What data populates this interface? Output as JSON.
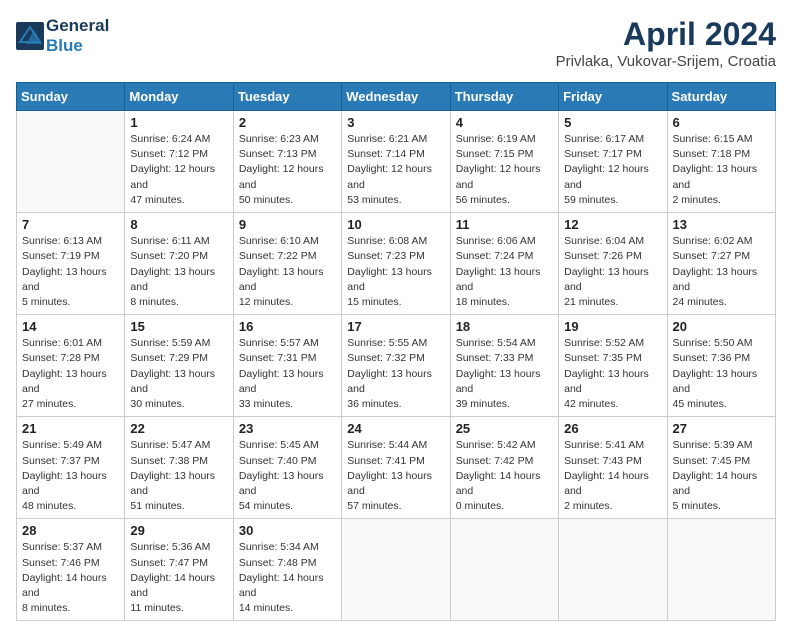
{
  "header": {
    "logo_line1": "General",
    "logo_line2": "Blue",
    "month": "April 2024",
    "location": "Privlaka, Vukovar-Srijem, Croatia"
  },
  "weekdays": [
    "Sunday",
    "Monday",
    "Tuesday",
    "Wednesday",
    "Thursday",
    "Friday",
    "Saturday"
  ],
  "weeks": [
    [
      {
        "day": "",
        "sunrise": "",
        "sunset": "",
        "daylight": ""
      },
      {
        "day": "1",
        "sunrise": "Sunrise: 6:24 AM",
        "sunset": "Sunset: 7:12 PM",
        "daylight": "Daylight: 12 hours and 47 minutes."
      },
      {
        "day": "2",
        "sunrise": "Sunrise: 6:23 AM",
        "sunset": "Sunset: 7:13 PM",
        "daylight": "Daylight: 12 hours and 50 minutes."
      },
      {
        "day": "3",
        "sunrise": "Sunrise: 6:21 AM",
        "sunset": "Sunset: 7:14 PM",
        "daylight": "Daylight: 12 hours and 53 minutes."
      },
      {
        "day": "4",
        "sunrise": "Sunrise: 6:19 AM",
        "sunset": "Sunset: 7:15 PM",
        "daylight": "Daylight: 12 hours and 56 minutes."
      },
      {
        "day": "5",
        "sunrise": "Sunrise: 6:17 AM",
        "sunset": "Sunset: 7:17 PM",
        "daylight": "Daylight: 12 hours and 59 minutes."
      },
      {
        "day": "6",
        "sunrise": "Sunrise: 6:15 AM",
        "sunset": "Sunset: 7:18 PM",
        "daylight": "Daylight: 13 hours and 2 minutes."
      }
    ],
    [
      {
        "day": "7",
        "sunrise": "Sunrise: 6:13 AM",
        "sunset": "Sunset: 7:19 PM",
        "daylight": "Daylight: 13 hours and 5 minutes."
      },
      {
        "day": "8",
        "sunrise": "Sunrise: 6:11 AM",
        "sunset": "Sunset: 7:20 PM",
        "daylight": "Daylight: 13 hours and 8 minutes."
      },
      {
        "day": "9",
        "sunrise": "Sunrise: 6:10 AM",
        "sunset": "Sunset: 7:22 PM",
        "daylight": "Daylight: 13 hours and 12 minutes."
      },
      {
        "day": "10",
        "sunrise": "Sunrise: 6:08 AM",
        "sunset": "Sunset: 7:23 PM",
        "daylight": "Daylight: 13 hours and 15 minutes."
      },
      {
        "day": "11",
        "sunrise": "Sunrise: 6:06 AM",
        "sunset": "Sunset: 7:24 PM",
        "daylight": "Daylight: 13 hours and 18 minutes."
      },
      {
        "day": "12",
        "sunrise": "Sunrise: 6:04 AM",
        "sunset": "Sunset: 7:26 PM",
        "daylight": "Daylight: 13 hours and 21 minutes."
      },
      {
        "day": "13",
        "sunrise": "Sunrise: 6:02 AM",
        "sunset": "Sunset: 7:27 PM",
        "daylight": "Daylight: 13 hours and 24 minutes."
      }
    ],
    [
      {
        "day": "14",
        "sunrise": "Sunrise: 6:01 AM",
        "sunset": "Sunset: 7:28 PM",
        "daylight": "Daylight: 13 hours and 27 minutes."
      },
      {
        "day": "15",
        "sunrise": "Sunrise: 5:59 AM",
        "sunset": "Sunset: 7:29 PM",
        "daylight": "Daylight: 13 hours and 30 minutes."
      },
      {
        "day": "16",
        "sunrise": "Sunrise: 5:57 AM",
        "sunset": "Sunset: 7:31 PM",
        "daylight": "Daylight: 13 hours and 33 minutes."
      },
      {
        "day": "17",
        "sunrise": "Sunrise: 5:55 AM",
        "sunset": "Sunset: 7:32 PM",
        "daylight": "Daylight: 13 hours and 36 minutes."
      },
      {
        "day": "18",
        "sunrise": "Sunrise: 5:54 AM",
        "sunset": "Sunset: 7:33 PM",
        "daylight": "Daylight: 13 hours and 39 minutes."
      },
      {
        "day": "19",
        "sunrise": "Sunrise: 5:52 AM",
        "sunset": "Sunset: 7:35 PM",
        "daylight": "Daylight: 13 hours and 42 minutes."
      },
      {
        "day": "20",
        "sunrise": "Sunrise: 5:50 AM",
        "sunset": "Sunset: 7:36 PM",
        "daylight": "Daylight: 13 hours and 45 minutes."
      }
    ],
    [
      {
        "day": "21",
        "sunrise": "Sunrise: 5:49 AM",
        "sunset": "Sunset: 7:37 PM",
        "daylight": "Daylight: 13 hours and 48 minutes."
      },
      {
        "day": "22",
        "sunrise": "Sunrise: 5:47 AM",
        "sunset": "Sunset: 7:38 PM",
        "daylight": "Daylight: 13 hours and 51 minutes."
      },
      {
        "day": "23",
        "sunrise": "Sunrise: 5:45 AM",
        "sunset": "Sunset: 7:40 PM",
        "daylight": "Daylight: 13 hours and 54 minutes."
      },
      {
        "day": "24",
        "sunrise": "Sunrise: 5:44 AM",
        "sunset": "Sunset: 7:41 PM",
        "daylight": "Daylight: 13 hours and 57 minutes."
      },
      {
        "day": "25",
        "sunrise": "Sunrise: 5:42 AM",
        "sunset": "Sunset: 7:42 PM",
        "daylight": "Daylight: 14 hours and 0 minutes."
      },
      {
        "day": "26",
        "sunrise": "Sunrise: 5:41 AM",
        "sunset": "Sunset: 7:43 PM",
        "daylight": "Daylight: 14 hours and 2 minutes."
      },
      {
        "day": "27",
        "sunrise": "Sunrise: 5:39 AM",
        "sunset": "Sunset: 7:45 PM",
        "daylight": "Daylight: 14 hours and 5 minutes."
      }
    ],
    [
      {
        "day": "28",
        "sunrise": "Sunrise: 5:37 AM",
        "sunset": "Sunset: 7:46 PM",
        "daylight": "Daylight: 14 hours and 8 minutes."
      },
      {
        "day": "29",
        "sunrise": "Sunrise: 5:36 AM",
        "sunset": "Sunset: 7:47 PM",
        "daylight": "Daylight: 14 hours and 11 minutes."
      },
      {
        "day": "30",
        "sunrise": "Sunrise: 5:34 AM",
        "sunset": "Sunset: 7:48 PM",
        "daylight": "Daylight: 14 hours and 14 minutes."
      },
      {
        "day": "",
        "sunrise": "",
        "sunset": "",
        "daylight": ""
      },
      {
        "day": "",
        "sunrise": "",
        "sunset": "",
        "daylight": ""
      },
      {
        "day": "",
        "sunrise": "",
        "sunset": "",
        "daylight": ""
      },
      {
        "day": "",
        "sunrise": "",
        "sunset": "",
        "daylight": ""
      }
    ]
  ]
}
